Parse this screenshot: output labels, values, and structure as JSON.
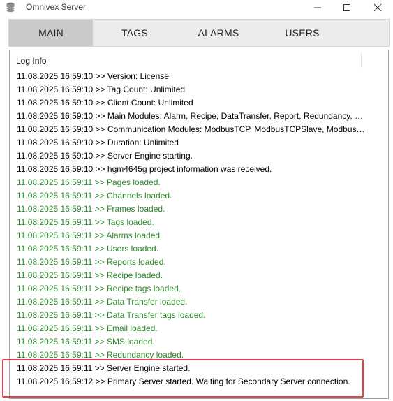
{
  "window": {
    "title": "Omnivex Server",
    "icon": "database-icon"
  },
  "tabs": [
    {
      "label": "MAIN",
      "active": true
    },
    {
      "label": "TAGS",
      "active": false
    },
    {
      "label": "ALARMS",
      "active": false
    },
    {
      "label": "USERS",
      "active": false
    }
  ],
  "log": {
    "header": "Log Info",
    "colors": {
      "info": "#000000",
      "success": "#2a8a2a",
      "highlight": "#e0444c"
    },
    "lines": [
      {
        "text": "11.08.2025 16:59:10 >> Version: License",
        "level": "info"
      },
      {
        "text": "11.08.2025 16:59:10 >> Tag Count: Unlimited",
        "level": "info"
      },
      {
        "text": "11.08.2025 16:59:10 >> Client Count: Unlimited",
        "level": "info"
      },
      {
        "text": "11.08.2025 16:59:10 >> Main Modules: Alarm, Recipe, DataTransfer, Report, Redundancy, We...",
        "level": "info"
      },
      {
        "text": "11.08.2025 16:59:10 >> Communication Modules: ModbusTCP, ModbusTCPSlave, ModbusR...",
        "level": "info"
      },
      {
        "text": "11.08.2025 16:59:10 >> Duration: Unlimited",
        "level": "info"
      },
      {
        "text": "11.08.2025 16:59:10 >> Server Engine starting.",
        "level": "info"
      },
      {
        "text": "11.08.2025 16:59:10 >> hgm4645g project information was received.",
        "level": "info"
      },
      {
        "text": "11.08.2025 16:59:11 >> Pages loaded.",
        "level": "ok"
      },
      {
        "text": "11.08.2025 16:59:11 >> Channels loaded.",
        "level": "ok"
      },
      {
        "text": "11.08.2025 16:59:11 >> Frames loaded.",
        "level": "ok"
      },
      {
        "text": "11.08.2025 16:59:11 >> Tags loaded.",
        "level": "ok"
      },
      {
        "text": "11.08.2025 16:59:11 >> Alarms loaded.",
        "level": "ok"
      },
      {
        "text": "11.08.2025 16:59:11 >> Users loaded.",
        "level": "ok"
      },
      {
        "text": "11.08.2025 16:59:11 >> Reports loaded.",
        "level": "ok"
      },
      {
        "text": "11.08.2025 16:59:11 >> Recipe loaded.",
        "level": "ok"
      },
      {
        "text": "11.08.2025 16:59:11 >> Recipe tags loaded.",
        "level": "ok"
      },
      {
        "text": "11.08.2025 16:59:11 >> Data Transfer loaded.",
        "level": "ok"
      },
      {
        "text": "11.08.2025 16:59:11 >> Data Transfer tags loaded.",
        "level": "ok"
      },
      {
        "text": "11.08.2025 16:59:11 >> Email loaded.",
        "level": "ok"
      },
      {
        "text": "11.08.2025 16:59:11 >> SMS loaded.",
        "level": "ok"
      },
      {
        "text": "11.08.2025 16:59:11 >> Redundancy loaded.",
        "level": "ok"
      },
      {
        "text": "11.08.2025 16:59:11 >> Server Engine started.",
        "level": "info"
      },
      {
        "text": "11.08.2025 16:59:12 >> Primary Server started. Waiting for Secondary Server connection.",
        "level": "info"
      }
    ]
  }
}
